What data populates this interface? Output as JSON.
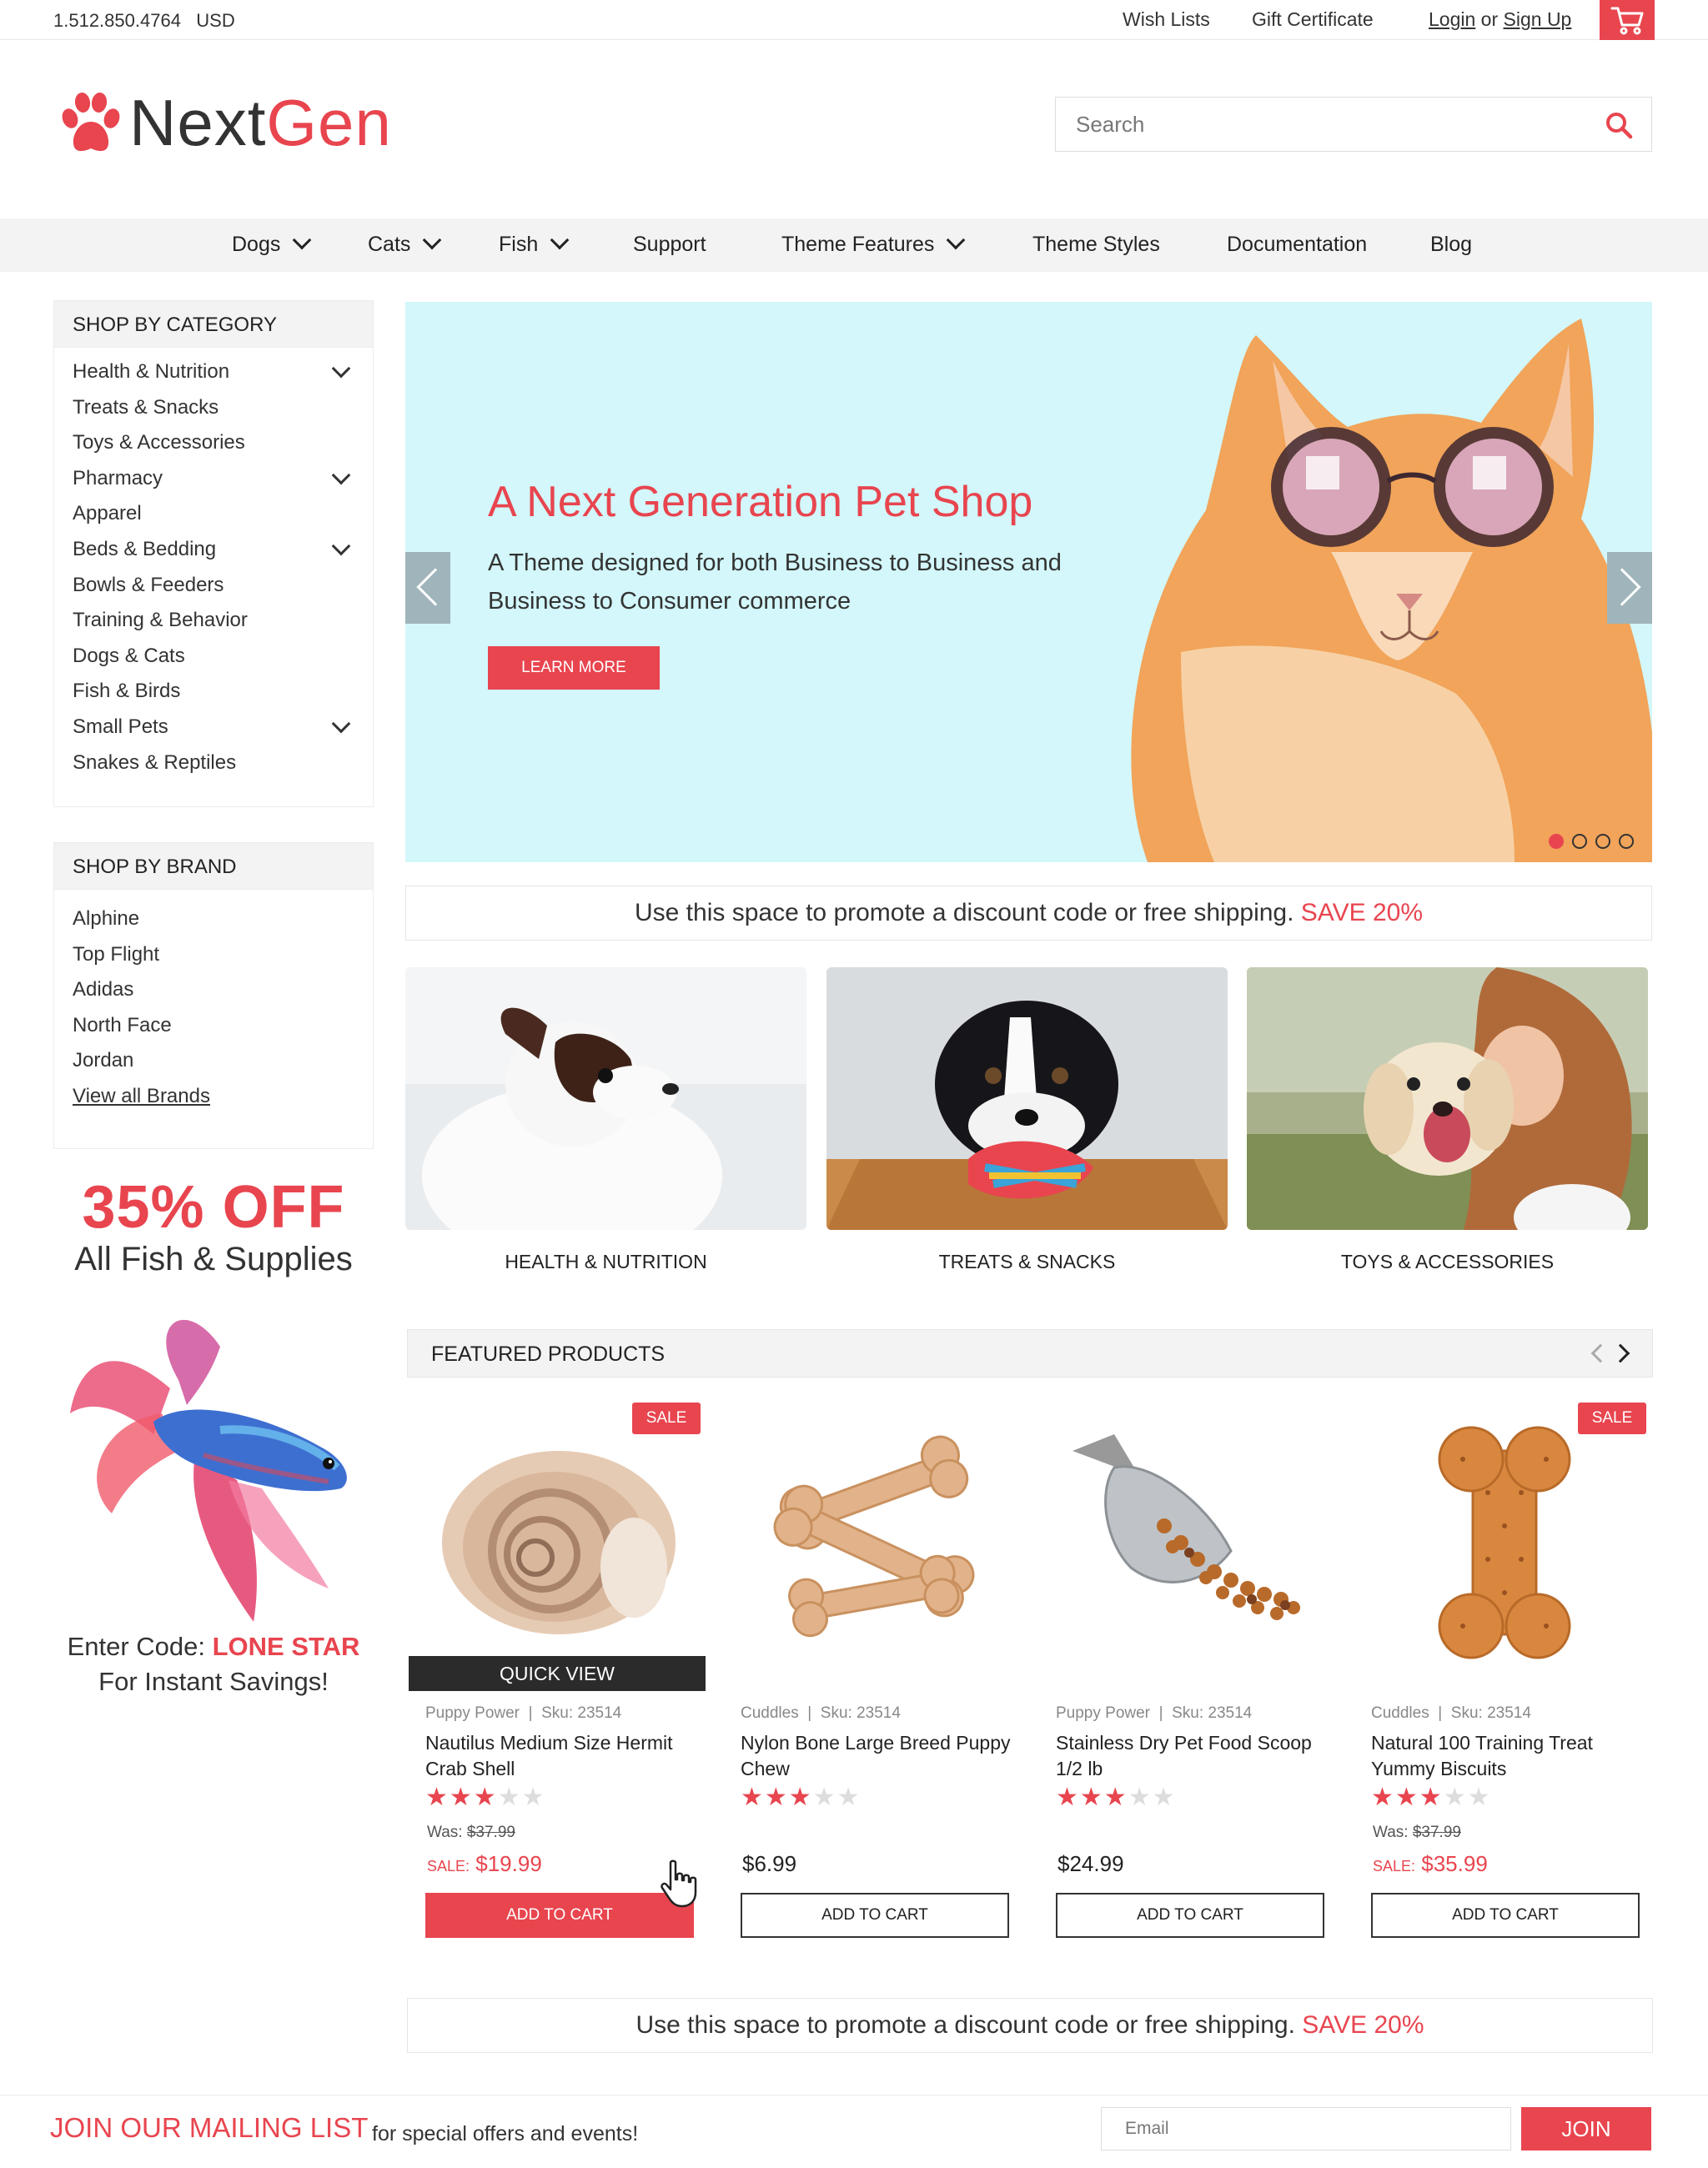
{
  "topbar": {
    "phone": "1.512.850.4764",
    "currency": "USD",
    "wish_lists": "Wish Lists",
    "gift_certificate": "Gift Certificate",
    "login": "Login",
    "or": "or",
    "sign_up": "Sign Up",
    "cart_icon": "cart-icon"
  },
  "brand": {
    "logo_icon": "paw-icon",
    "name_part1": "Next",
    "name_part2": "Gen",
    "accent_color": "#e8454f"
  },
  "search": {
    "placeholder": "Search",
    "icon": "search-icon"
  },
  "nav": {
    "items": [
      {
        "label": "Dogs",
        "dropdown": true
      },
      {
        "label": "Cats",
        "dropdown": true
      },
      {
        "label": "Fish",
        "dropdown": true
      },
      {
        "label": "Support",
        "dropdown": false
      },
      {
        "label": "Theme Features",
        "dropdown": true
      },
      {
        "label": "Theme Styles",
        "dropdown": false
      },
      {
        "label": "Documentation",
        "dropdown": false
      },
      {
        "label": "Blog",
        "dropdown": false
      }
    ]
  },
  "sidebar": {
    "category_title": "SHOP BY CATEGORY",
    "categories": [
      {
        "label": "Health & Nutrition",
        "expandable": true
      },
      {
        "label": "Treats & Snacks",
        "expandable": false
      },
      {
        "label": "Toys & Accessories",
        "expandable": false
      },
      {
        "label": "Pharmacy",
        "expandable": true
      },
      {
        "label": "Apparel",
        "expandable": false
      },
      {
        "label": "Beds & Bedding",
        "expandable": true
      },
      {
        "label": "Bowls & Feeders",
        "expandable": false
      },
      {
        "label": "Training & Behavior",
        "expandable": false
      },
      {
        "label": "Dogs & Cats",
        "expandable": false
      },
      {
        "label": "Fish & Birds",
        "expandable": false
      },
      {
        "label": "Small Pets",
        "expandable": true
      },
      {
        "label": "Snakes & Reptiles",
        "expandable": false
      }
    ],
    "brand_title": "SHOP BY BRAND",
    "brands": [
      "Alphine",
      "Top Flight",
      "Adidas",
      "North Face",
      "Jordan"
    ],
    "view_all": "View all Brands",
    "promo": {
      "headline": "35% OFF",
      "subline": "All Fish & Supplies",
      "code_prefix": "Enter Code:",
      "code": "LONE STAR",
      "code_suffix": "For Instant Savings!"
    }
  },
  "hero": {
    "title": "A Next Generation Pet Shop",
    "description": "A Theme designed for both Business to Business and Business to Consumer commerce",
    "button": "LEARN MORE",
    "slide_count": 4,
    "active_slide": 1,
    "bg_color": "#d3f7fa"
  },
  "promo_strip": {
    "text": "Use this space to promote a discount code or free shipping.",
    "highlight": "SAVE 20%"
  },
  "categories": [
    {
      "label": "HEALTH & NUTRITION"
    },
    {
      "label": "TREATS & SNACKS"
    },
    {
      "label": "TOYS & ACCESSORIES"
    }
  ],
  "featured": {
    "title": "FEATURED PRODUCTS",
    "products": [
      {
        "brand": "Puppy Power",
        "sku_label": "Sku:",
        "sku": "23514",
        "name": "Nautilus Medium Size Hermit Crab Shell",
        "rating": 3,
        "sale": true,
        "badge": "SALE",
        "was_label": "Was:",
        "was": "$37.99",
        "sale_label": "SALE:",
        "price": "$19.99",
        "button": "ADD TO CART",
        "quick_view": "QUICK VIEW"
      },
      {
        "brand": "Cuddles",
        "sku_label": "Sku:",
        "sku": "23514",
        "name": "Nylon Bone Large Breed Puppy Chew",
        "rating": 3,
        "sale": false,
        "price": "$6.99",
        "button": "ADD TO CART"
      },
      {
        "brand": "Puppy Power",
        "sku_label": "Sku:",
        "sku": "23514",
        "name": "Stainless Dry Pet Food Scoop 1/2 lb",
        "rating": 3,
        "sale": false,
        "price": "$24.99",
        "button": "ADD TO CART"
      },
      {
        "brand": "Cuddles",
        "sku_label": "Sku:",
        "sku": "23514",
        "name": "Natural 100 Training Treat Yummy Biscuits",
        "rating": 3,
        "sale": true,
        "badge": "SALE",
        "was_label": "Was:",
        "was": "$37.99",
        "sale_label": "SALE:",
        "price": "$35.99",
        "button": "ADD TO CART"
      }
    ]
  },
  "mailing": {
    "title": "JOIN OUR MAILING LIST",
    "subtitle": "for special offers and events!",
    "placeholder": "Email",
    "button": "JOIN"
  }
}
